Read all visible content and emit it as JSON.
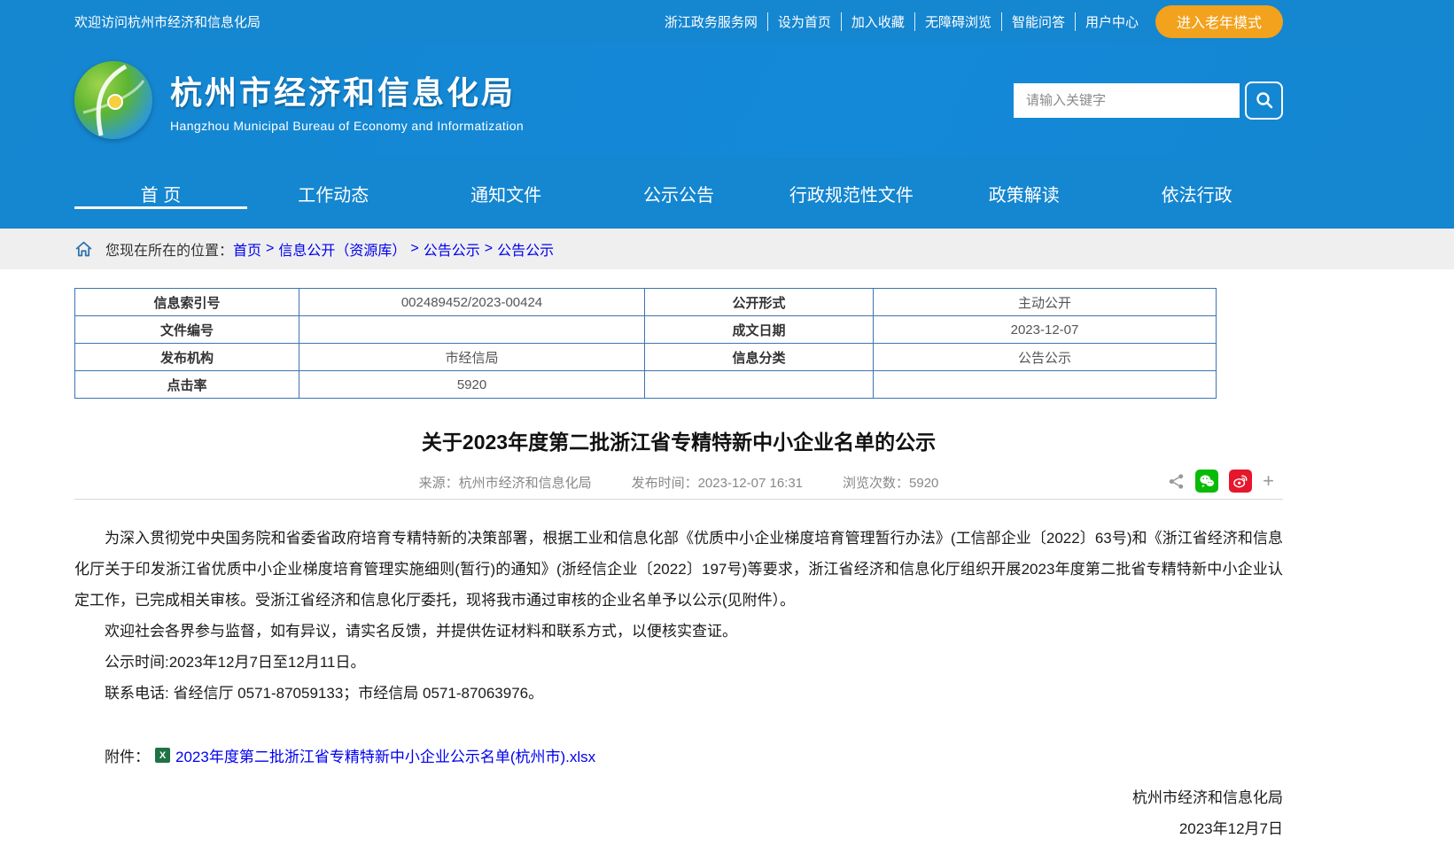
{
  "topbar": {
    "welcome": "欢迎访问杭州市经济和信息化局",
    "links": [
      "浙江政务服务网",
      "设为首页",
      "加入收藏",
      "无障碍浏览",
      "智能问答",
      "用户中心"
    ],
    "elder_mode_label": "进入老年模式"
  },
  "header": {
    "site_title": "杭州市经济和信息化局",
    "site_subtitle": "Hangzhou Municipal Bureau of Economy and Informatization",
    "search_placeholder": "请输入关键字"
  },
  "nav": {
    "items": [
      {
        "label": "首 页",
        "active": true
      },
      {
        "label": "工作动态",
        "active": false
      },
      {
        "label": "通知文件",
        "active": false
      },
      {
        "label": "公示公告",
        "active": false
      },
      {
        "label": "行政规范性文件",
        "active": false
      },
      {
        "label": "政策解读",
        "active": false
      },
      {
        "label": "依法行政",
        "active": false
      }
    ]
  },
  "breadcrumb": {
    "prefix": "您现在所在的位置：",
    "separator": ">",
    "items": [
      "首页",
      "信息公开（资源库）",
      "公告公示",
      "公告公示"
    ]
  },
  "info_table": {
    "rows": [
      [
        "信息索引号",
        "002489452/2023-00424",
        "公开形式",
        "主动公开"
      ],
      [
        "文件编号",
        "",
        "成文日期",
        "2023-12-07"
      ],
      [
        "发布机构",
        "市经信局",
        "信息分类",
        "公告公示"
      ],
      [
        "点击率",
        "5920",
        "",
        ""
      ]
    ]
  },
  "article": {
    "title": "关于2023年度第二批浙江省专精特新中小企业名单的公示",
    "source": "来源：杭州市经济和信息化局",
    "publish_time": "发布时间：2023-12-07 16:31",
    "views": "浏览次数：5920",
    "paragraphs": [
      "为深入贯彻党中央国务院和省委省政府培育专精特新的决策部署，根据工业和信息化部《优质中小企业梯度培育管理暂行办法》(工信部企业〔2022〕63号)和《浙江省经济和信息化厅关于印发浙江省优质中小企业梯度培育管理实施细则(暂行)的通知》(浙经信企业〔2022〕197号)等要求，浙江省经济和信息化厅组织开展2023年度第二批省专精特新中小企业认定工作，已完成相关审核。受浙江省经济和信息化厅委托，现将我市通过审核的企业名单予以公示(见附件）。",
      "欢迎社会各界参与监督，如有异议，请实名反馈，并提供佐证材料和联系方式，以便核实查证。",
      "公示时间:2023年12月7日至12月11日。",
      "联系电话: 省经信厅 0571-87059133；市经信局 0571-87063976。"
    ],
    "attachment_label": "附件：",
    "attachment_name": "2023年度第二批浙江省专精特新中小企业公示名单(杭州市).xlsx",
    "signature": "杭州市经济和信息化局",
    "date": "2023年12月7日"
  },
  "icons": {
    "plus": "+",
    "excel_glyph": "X"
  },
  "colors": {
    "primary_blue": "#1586d0",
    "elder_orange": "#f2a21c",
    "link_blue": "#0000ee",
    "table_border_blue": "#3e74b2",
    "wechat_green": "#09bb07",
    "weibo_red": "#e6162d",
    "breadcrumb_gray": "#efefef"
  }
}
